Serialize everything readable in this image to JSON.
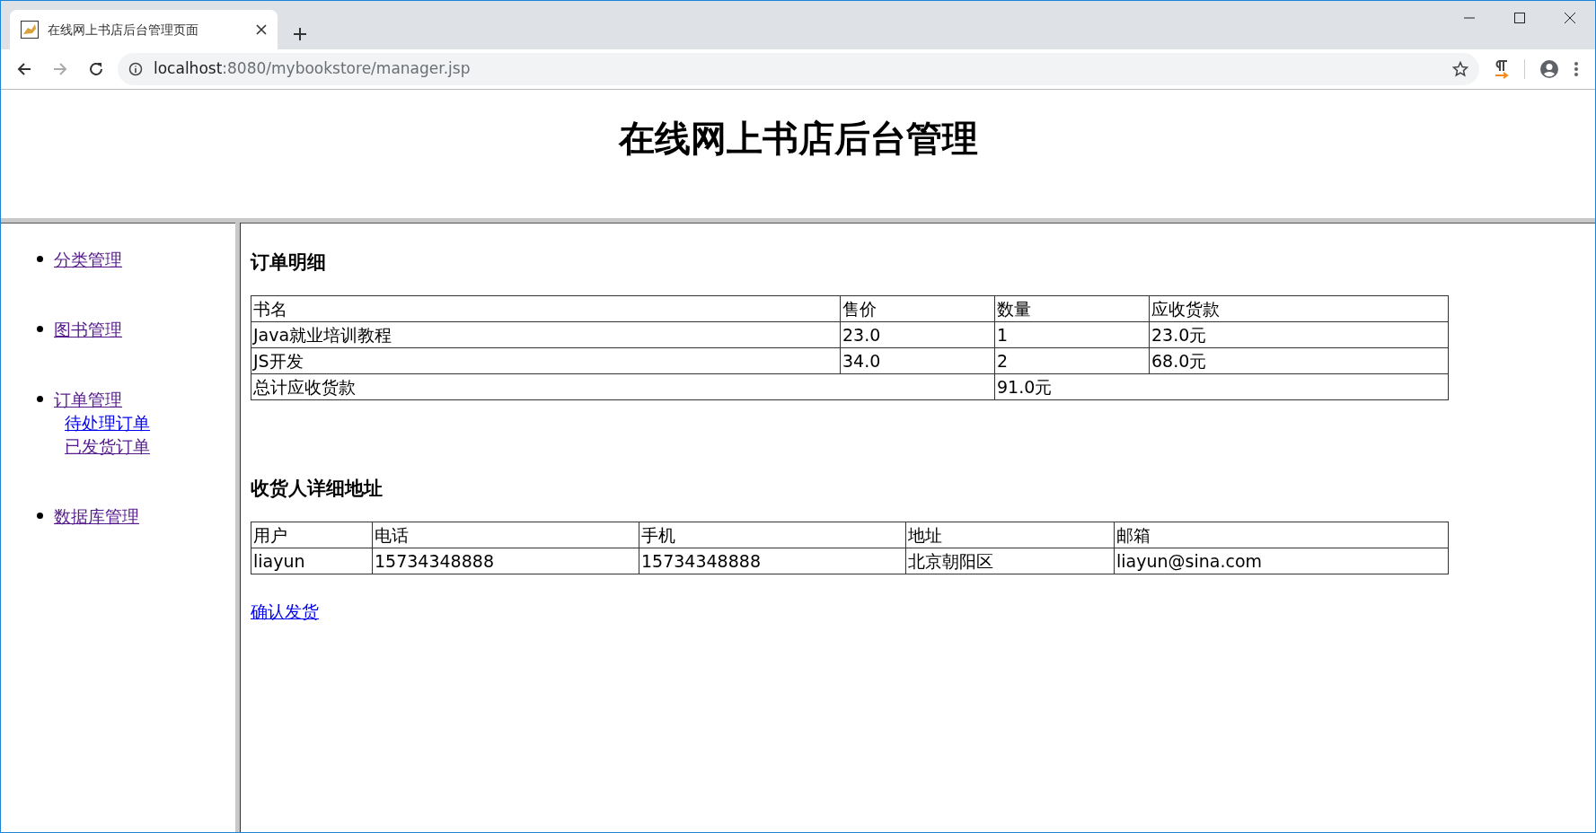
{
  "browser": {
    "tab": {
      "title": "在线网上书店后台管理页面"
    },
    "address": {
      "host": "localhost",
      "path": ":8080/mybookstore/manager.jsp"
    }
  },
  "header": {
    "title": "在线网上书店后台管理"
  },
  "sidebar": {
    "items": [
      {
        "label": "分类管理",
        "visited": true
      },
      {
        "label": "图书管理",
        "visited": true
      },
      {
        "label": "订单管理",
        "visited": true,
        "children": [
          {
            "label": "待处理订单",
            "visited": false
          },
          {
            "label": "已发货订单",
            "visited": true
          }
        ]
      },
      {
        "label": "数据库管理",
        "visited": true
      }
    ]
  },
  "order_details": {
    "heading": "订单明细",
    "columns": [
      "书名",
      "售价",
      "数量",
      "应收货款"
    ],
    "rows": [
      [
        "Java就业培训教程",
        "23.0",
        "1",
        "23.0元"
      ],
      [
        "JS开发",
        "34.0",
        "2",
        "68.0元"
      ]
    ],
    "total": {
      "label": "总计应收货款",
      "value": "91.0元"
    }
  },
  "recipient": {
    "heading": "收货人详细地址",
    "columns": [
      "用户",
      "电话",
      "手机",
      "地址",
      "邮箱"
    ],
    "rows": [
      [
        "liayun",
        "15734348888",
        "15734348888",
        "北京朝阳区",
        "liayun@sina.com"
      ]
    ]
  },
  "confirm_link": {
    "label": "确认发货",
    "visited": false
  }
}
